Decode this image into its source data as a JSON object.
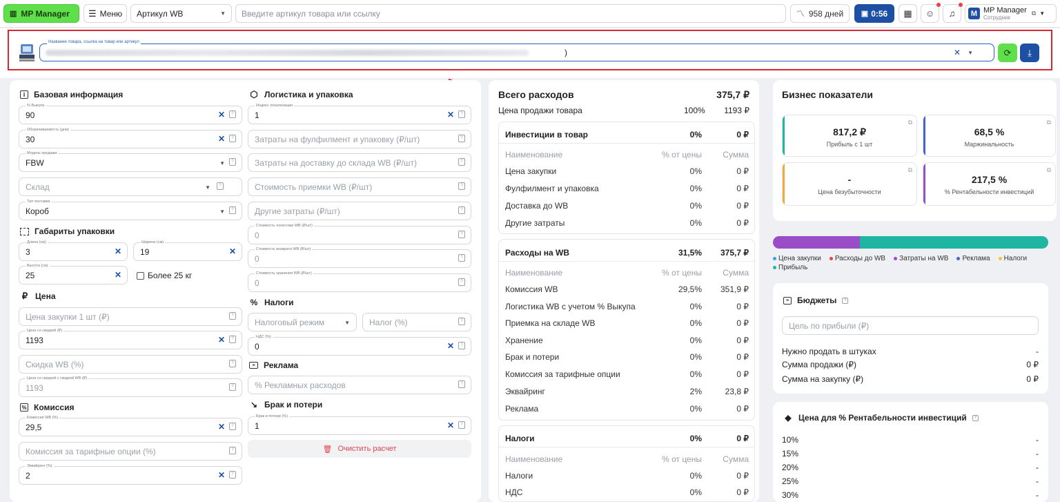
{
  "topbar": {
    "logo": "MP Manager",
    "menu": "Меню",
    "articul_select": "Артикул WB",
    "search_placeholder": "Введите артикул товара или ссылку",
    "days": "958 дней",
    "timer": "0:56",
    "account_name": "MP Manager",
    "account_role": "Сотрудник"
  },
  "product": {
    "label": "Название товара, ссылка на товар или артикул",
    "value_suffix": ")"
  },
  "left": {
    "base_title": "Базовая информация",
    "buyout_label": "% Выкупа",
    "buyout_value": "90",
    "turnover_label": "Оборачиваемость (дни)",
    "turnover_value": "30",
    "model_label": "Модель продажи",
    "model_value": "FBW",
    "warehouse_placeholder": "Склад",
    "supply_label": "Тип поставки",
    "supply_value": "Короб",
    "dims_title": "Габариты упаковки",
    "length_label": "Длина (см)",
    "length_value": "3",
    "width_label": "Ширина (см)",
    "width_value": "19",
    "height_label": "Высота (см)",
    "height_value": "25",
    "over25": "Более 25 кг",
    "price_title": "Цена",
    "purchase_placeholder": "Цена закупки 1 шт (₽)",
    "discount_price_label": "Цена со скидкой (₽)",
    "discount_price_value": "1193",
    "wb_discount_placeholder": "Скидка WB (%)",
    "wb_price_label": "Цена со скидкой с скидкой WB (₽)",
    "wb_price_value": "1193",
    "commission_title": "Комиссия",
    "commission_label": "Комиссия WB (%)",
    "commission_value": "29,5",
    "tariff_placeholder": "Комиссия за тарифные опции (%)",
    "acquiring_label": "Эквайринг (%)",
    "acquiring_value": "2"
  },
  "mid": {
    "logistics_title": "Логистика и упаковка",
    "index_label": "Индекс локализации",
    "index_value": "1",
    "fulfil_placeholder": "Затраты на фулфилмент и упаковку (₽/шт)",
    "delivery_placeholder": "Затраты на доставку до склада WB (₽/шт)",
    "acceptance_placeholder": "Стоимость приемки WB (₽/шт)",
    "other_placeholder": "Другие затраты (₽/шт)",
    "logistics_wb_label": "Стоимость логистики WB (₽/шт)",
    "logistics_wb_value": "0",
    "return_label": "Стоимость возврата WB (₽/шт)",
    "return_value": "0",
    "storage_label": "Стоимость хранения WB (₽/шт)",
    "storage_value": "0",
    "taxes_title": "Налоги",
    "tax_mode_placeholder": "Налоговый режим",
    "tax_placeholder": "Налог (%)",
    "vat_label": "НДС (%)",
    "vat_value": "0",
    "ads_title": "Реклама",
    "ads_placeholder": "% Рекламных расходов",
    "defect_title": "Брак и потери",
    "defect_label": "Брак и потери (%)",
    "defect_value": "1",
    "clear": "Очистить расчет"
  },
  "expenses": {
    "title": "Всего расходов",
    "total": "375,7 ₽",
    "sale_price_label": "Цена продажи товара",
    "sale_price_pct": "100%",
    "sale_price": "1193 ₽",
    "col_name": "Наименование",
    "col_pct": "% от цены",
    "col_sum": "Сумма",
    "investments": {
      "title": "Инвестиции в товар",
      "pct": "0%",
      "sum": "0 ₽",
      "rows": [
        {
          "name": "Цена закупки",
          "pct": "0%",
          "sum": "0 ₽"
        },
        {
          "name": "Фулфилмент и упаковка",
          "pct": "0%",
          "sum": "0 ₽"
        },
        {
          "name": "Доставка до WB",
          "pct": "0%",
          "sum": "0 ₽"
        },
        {
          "name": "Другие затраты",
          "pct": "0%",
          "sum": "0 ₽"
        }
      ]
    },
    "wb": {
      "title": "Расходы на WB",
      "pct": "31,5%",
      "sum": "375,7 ₽",
      "rows": [
        {
          "name": "Комиссия WB",
          "pct": "29,5%",
          "sum": "351,9 ₽"
        },
        {
          "name": "Логистика WB с учетом % Выкупа",
          "pct": "0%",
          "sum": "0 ₽"
        },
        {
          "name": "Приемка на складе WB",
          "pct": "0%",
          "sum": "0 ₽"
        },
        {
          "name": "Хранение",
          "pct": "0%",
          "sum": "0 ₽"
        },
        {
          "name": "Брак и потери",
          "pct": "0%",
          "sum": "0 ₽"
        },
        {
          "name": "Комиссия за тарифные опции",
          "pct": "0%",
          "sum": "0 ₽"
        },
        {
          "name": "Эквайринг",
          "pct": "2%",
          "sum": "23,8 ₽"
        },
        {
          "name": "Реклама",
          "pct": "0%",
          "sum": "0 ₽"
        }
      ]
    },
    "taxes": {
      "title": "Налоги",
      "pct": "0%",
      "sum": "0 ₽",
      "rows": [
        {
          "name": "Налоги",
          "pct": "0%",
          "sum": "0 ₽"
        },
        {
          "name": "НДС",
          "pct": "0%",
          "sum": "0 ₽"
        }
      ]
    }
  },
  "business": {
    "title": "Бизнес показатели",
    "kpis": [
      {
        "value": "817,2 ₽",
        "label": "Прибыль с 1 шт",
        "color": "#1fb5a3"
      },
      {
        "value": "68,5 %",
        "label": "Маржинальность",
        "color": "#4a62c9"
      },
      {
        "value": "-",
        "label": "Цена безубыточности",
        "color": "#f2a93b"
      },
      {
        "value": "217,5 %",
        "label": "% Рентабельности инвестиций",
        "color": "#9b4cc7"
      }
    ],
    "bar": {
      "purple_share": 0.315,
      "teal_share": 0.685,
      "purple": "#9b4cc7",
      "teal": "#1fb5a3"
    },
    "legend": [
      {
        "label": "Цена закупки",
        "color": "#3aa0e8"
      },
      {
        "label": "Расходы до WB",
        "color": "#e8414b"
      },
      {
        "label": "Затраты на WB",
        "color": "#9b4cc7"
      },
      {
        "label": "Реклама",
        "color": "#4a62c9"
      },
      {
        "label": "Налоги",
        "color": "#f2c43b"
      },
      {
        "label": "Прибыль",
        "color": "#1fb5a3"
      }
    ],
    "budgets_title": "Бюджеты",
    "goal_placeholder": "Цель по прибыли (₽)",
    "budget_rows": [
      {
        "label": "Нужно продать в штуках",
        "value": "-"
      },
      {
        "label": "Сумма продажи (₽)",
        "value": "0 ₽"
      },
      {
        "label": "Сумма на закупку (₽)",
        "value": "0 ₽"
      }
    ],
    "roi_title": "Цена для % Рентабельности инвестиций",
    "roi_rows": [
      {
        "label": "10%",
        "value": "-"
      },
      {
        "label": "15%",
        "value": "-"
      },
      {
        "label": "20%",
        "value": "-"
      },
      {
        "label": "25%",
        "value": "-"
      },
      {
        "label": "30%",
        "value": "-"
      }
    ]
  }
}
